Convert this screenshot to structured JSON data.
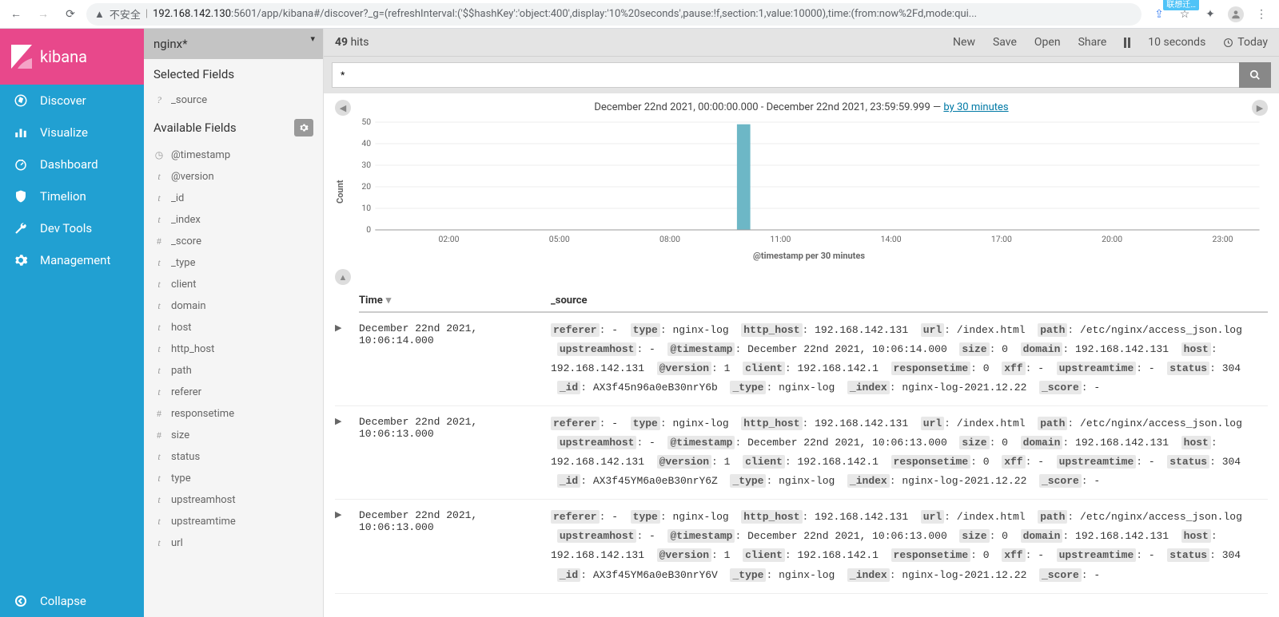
{
  "browser": {
    "insecure_label": "不安全",
    "url_host": "192.168.142.130",
    "url_path": ":5601/app/kibana#/discover?_g=(refreshInterval:('$$hashKey':'object:400',display:'10%20seconds',pause:!f,section:1,value:10000),time:(from:now%2Fd,mode:qui...",
    "ext_badge": "联想迁…"
  },
  "logo_text": "kibana",
  "nav": [
    {
      "icon": "compass",
      "label": "Discover"
    },
    {
      "icon": "barchart",
      "label": "Visualize"
    },
    {
      "icon": "dashboard",
      "label": "Dashboard"
    },
    {
      "icon": "shield",
      "label": "Timelion"
    },
    {
      "icon": "wrench",
      "label": "Dev Tools"
    },
    {
      "icon": "gear",
      "label": "Management"
    }
  ],
  "collapse_label": "Collapse",
  "index_pattern": "nginx*",
  "selected_fields_label": "Selected Fields",
  "selected_fields": [
    {
      "type": "?",
      "name": "_source"
    }
  ],
  "available_fields_label": "Available Fields",
  "available_fields": [
    {
      "type": "clock",
      "name": "@timestamp"
    },
    {
      "type": "t",
      "name": "@version"
    },
    {
      "type": "t",
      "name": "_id"
    },
    {
      "type": "t",
      "name": "_index"
    },
    {
      "type": "#",
      "name": "_score"
    },
    {
      "type": "t",
      "name": "_type"
    },
    {
      "type": "t",
      "name": "client"
    },
    {
      "type": "t",
      "name": "domain"
    },
    {
      "type": "t",
      "name": "host"
    },
    {
      "type": "t",
      "name": "http_host"
    },
    {
      "type": "t",
      "name": "path"
    },
    {
      "type": "t",
      "name": "referer"
    },
    {
      "type": "#",
      "name": "responsetime"
    },
    {
      "type": "#",
      "name": "size"
    },
    {
      "type": "t",
      "name": "status"
    },
    {
      "type": "t",
      "name": "type"
    },
    {
      "type": "t",
      "name": "upstreamhost"
    },
    {
      "type": "t",
      "name": "upstreamtime"
    },
    {
      "type": "t",
      "name": "url"
    }
  ],
  "topbar": {
    "hits_count": "49",
    "hits_label": "hits",
    "new": "New",
    "save": "Save",
    "open": "Open",
    "share": "Share",
    "interval": "10 seconds",
    "today": "Today"
  },
  "search_query": "*",
  "timerange": {
    "text_before": "December 22nd 2021, 00:00:00.000 - December 22nd 2021, 23:59:59.999 — ",
    "interval_link": "by 30 minutes"
  },
  "chart_data": {
    "type": "bar",
    "ylabel": "Count",
    "xlabel": "@timestamp per 30 minutes",
    "ylim": [
      0,
      50
    ],
    "yticks": [
      0,
      10,
      20,
      30,
      40,
      50
    ],
    "xticks": [
      "02:00",
      "05:00",
      "08:00",
      "11:00",
      "14:00",
      "17:00",
      "20:00",
      "23:00"
    ],
    "series": [
      {
        "name": "Count",
        "x": "10:00",
        "y": 49
      }
    ],
    "bar_color": "#6db7c6"
  },
  "doc_table": {
    "col_time": "Time",
    "col_source": "_source",
    "rows": [
      {
        "time": "December 22nd 2021, 10:06:14.000",
        "fields": {
          "referer": "-",
          "type": "nginx-log",
          "http_host": "192.168.142.131",
          "url": "/index.html",
          "path": "/etc/nginx/access_json.log",
          "upstreamhost": "-",
          "@timestamp": "December 22nd 2021, 10:06:14.000",
          "size": "0",
          "domain": "192.168.142.131",
          "host": "192.168.142.131",
          "@version": "1",
          "client": "192.168.142.1",
          "responsetime": "0",
          "xff": "-",
          "upstreamtime": "-",
          "status": "304",
          "_id": "AX3f45n96a0eB30nrY6b",
          "_type": "nginx-log",
          "_index": "nginx-log-2021.12.22",
          "_score": "-"
        }
      },
      {
        "time": "December 22nd 2021, 10:06:13.000",
        "fields": {
          "referer": "-",
          "type": "nginx-log",
          "http_host": "192.168.142.131",
          "url": "/index.html",
          "path": "/etc/nginx/access_json.log",
          "upstreamhost": "-",
          "@timestamp": "December 22nd 2021, 10:06:13.000",
          "size": "0",
          "domain": "192.168.142.131",
          "host": "192.168.142.131",
          "@version": "1",
          "client": "192.168.142.1",
          "responsetime": "0",
          "xff": "-",
          "upstreamtime": "-",
          "status": "304",
          "_id": "AX3f45YM6a0eB30nrY6Z",
          "_type": "nginx-log",
          "_index": "nginx-log-2021.12.22",
          "_score": "-"
        }
      },
      {
        "time": "December 22nd 2021, 10:06:13.000",
        "fields": {
          "referer": "-",
          "type": "nginx-log",
          "http_host": "192.168.142.131",
          "url": "/index.html",
          "path": "/etc/nginx/access_json.log",
          "upstreamhost": "-",
          "@timestamp": "December 22nd 2021, 10:06:13.000",
          "size": "0",
          "domain": "192.168.142.131",
          "host": "192.168.142.131",
          "@version": "1",
          "client": "192.168.142.1",
          "responsetime": "0",
          "xff": "-",
          "upstreamtime": "-",
          "status": "304",
          "_id": "AX3f45YM6a0eB30nrY6V",
          "_type": "nginx-log",
          "_index": "nginx-log-2021.12.22",
          "_score": "-"
        }
      }
    ]
  }
}
